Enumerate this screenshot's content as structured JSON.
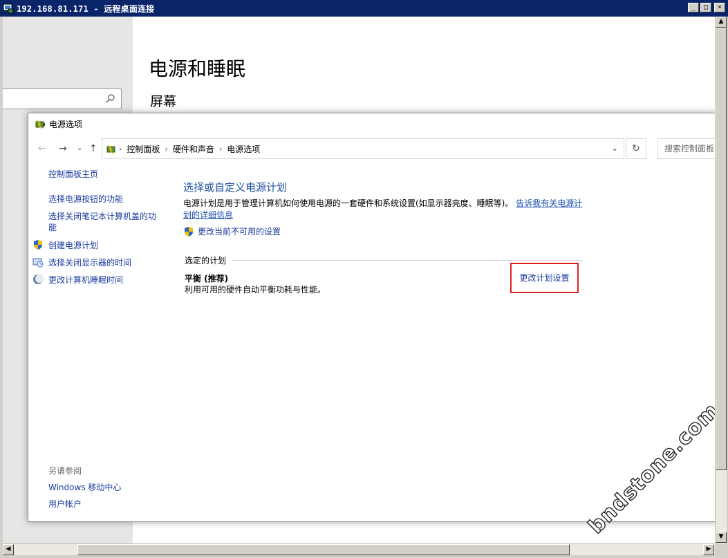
{
  "rdp": {
    "title": "192.168.81.171 - 远程桌面连接",
    "buttons": {
      "minimize": "_",
      "maximize": "□",
      "close": "×"
    }
  },
  "settings": {
    "title": "电源和睡眠",
    "subtitle": "屏幕",
    "search_icon": "search-icon"
  },
  "power_options": {
    "title": "电源选项",
    "breadcrumb": [
      "控制面板",
      "硬件和声音",
      "电源选项"
    ],
    "search_placeholder": "搜索控制面板",
    "left_links": {
      "home": "控制面板主页",
      "power_button": "选择电源按钮的功能",
      "lid": "选择关闭笔记本计算机盖的功能",
      "create_plan": "创建电源计划",
      "display_off": "选择关闭显示器的时间",
      "sleep": "更改计算机睡眠时间"
    },
    "see_also": {
      "label": "另请参阅",
      "mobility": "Windows 移动中心",
      "accounts": "用户帐户"
    },
    "main": {
      "heading": "选择或自定义电源计划",
      "desc_prefix": "电源计划是用于管理计算机如何使用电源的一套硬件和系统设置(如显示器亮度、睡眠等)。",
      "desc_link": "告诉我有关电源计划的详细信息",
      "unavailable_settings": "更改当前不可用的设置",
      "selected_plan_label": "选定的计划",
      "plan_name": "平衡 (推荐)",
      "plan_desc": "利用可用的硬件自动平衡功耗与性能。",
      "change_plan": "更改计划设置"
    }
  },
  "watermark": "bndstone.com",
  "colors": {
    "link": "#1a3b9e",
    "heading": "#1e50a0",
    "highlight_box": "#e02020",
    "rdp_title_bg": "#0a246a"
  }
}
